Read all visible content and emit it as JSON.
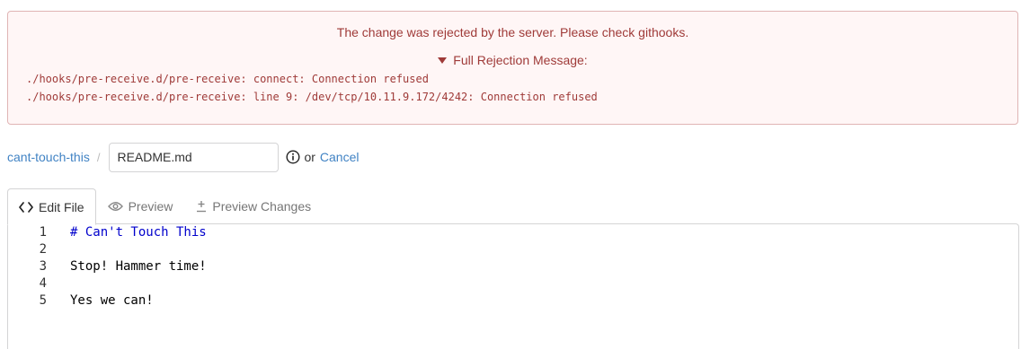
{
  "error": {
    "title": "The change was rejected by the server. Please check githooks.",
    "toggle_label": "Full Rejection Message:",
    "messages": [
      "./hooks/pre-receive.d/pre-receive: connect: Connection refused",
      "./hooks/pre-receive.d/pre-receive: line 9: /dev/tcp/10.11.9.172/4242: Connection refused"
    ]
  },
  "breadcrumb": {
    "repo": "cant-touch-this",
    "divider": "/",
    "filename_value": "README.md",
    "or_text": "or",
    "cancel_label": "Cancel"
  },
  "tabs": [
    {
      "label": "Edit File",
      "icon": "code-icon",
      "active": true
    },
    {
      "label": "Preview",
      "icon": "eye-icon",
      "active": false
    },
    {
      "label": "Preview Changes",
      "icon": "diff-icon",
      "active": false
    }
  ],
  "editor": {
    "lines": [
      {
        "num": "1",
        "text": "# Can't Touch This"
      },
      {
        "num": "2",
        "text": ""
      },
      {
        "num": "3",
        "text": "Stop! Hammer time!"
      },
      {
        "num": "4",
        "text": ""
      },
      {
        "num": "5",
        "text": "Yes we can!"
      }
    ]
  },
  "colors": {
    "error_text": "#9f3a38",
    "error_bg": "#fff6f6",
    "link": "#4183c4",
    "markdown_heading": "#0000cc"
  }
}
